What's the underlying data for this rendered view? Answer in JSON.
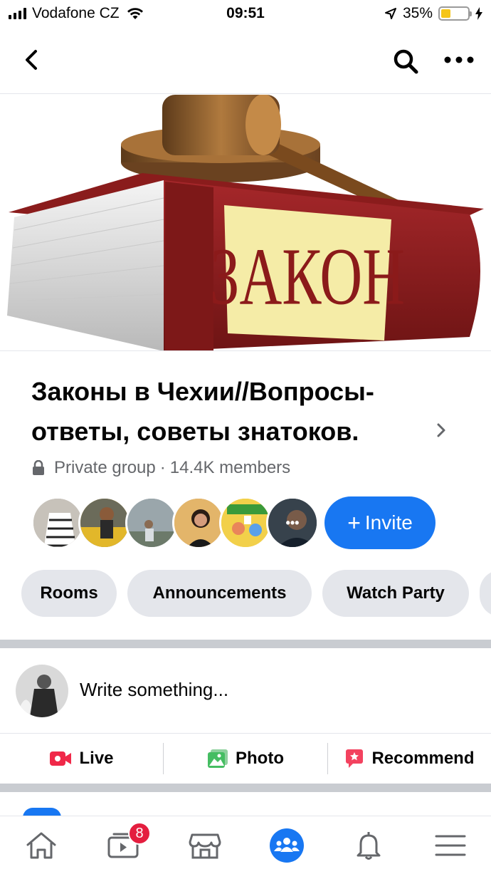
{
  "status_bar": {
    "carrier": "Vodafone CZ",
    "time": "09:51",
    "battery_percent": "35%",
    "battery_level": 0.35
  },
  "nav": {
    "back_icon": "chevron-left-icon",
    "search_icon": "search-icon",
    "more_icon": "more-dots-icon"
  },
  "cover": {
    "book_label": "ЗАКОН",
    "colors": {
      "book": "#8b1a1a",
      "label_bg": "#f5eca7",
      "gavel": "#8a5a2b"
    }
  },
  "group": {
    "title": "Законы в Чехии//Вопросы-ответы, советы знатоков.",
    "privacy": "Private group",
    "separator": "·",
    "members": "14.4K members"
  },
  "members_row": {
    "avatars": [
      {
        "name": "member-avatar-1",
        "color": "#b9b2a8"
      },
      {
        "name": "member-avatar-2",
        "color": "#c9a33a"
      },
      {
        "name": "member-avatar-3",
        "color": "#8e9aa0"
      },
      {
        "name": "member-avatar-4",
        "color": "#d9a55a"
      },
      {
        "name": "member-avatar-5",
        "color": "#f2c230"
      },
      {
        "name": "member-avatar-6",
        "color": "#3a4652"
      }
    ],
    "more_label": "•••",
    "invite_plus": "+",
    "invite_label": "Invite"
  },
  "chips": [
    "Rooms",
    "Announcements",
    "Watch Party"
  ],
  "composer": {
    "placeholder": "Write something..."
  },
  "actions": {
    "live": "Live",
    "photo": "Photo",
    "recommend": "Recommend",
    "colors": {
      "live": "#f02849",
      "photo": "#45bd62",
      "recommend": "#f3425f"
    }
  },
  "tab_bar": {
    "tabs": [
      "home-icon",
      "watch-icon",
      "marketplace-icon",
      "groups-icon",
      "notifications-icon",
      "menu-icon"
    ],
    "watch_badge": "8",
    "active_tab": "groups-icon",
    "accent": "#1877f2"
  }
}
